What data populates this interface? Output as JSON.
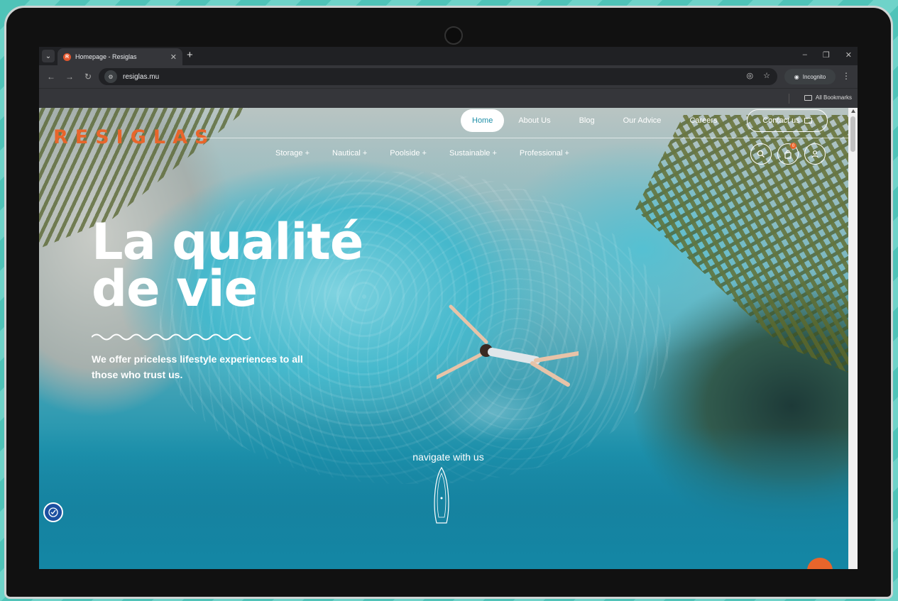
{
  "browser": {
    "tab_title": "Homepage - Resiglas",
    "favicon_letter": "R",
    "url": "resiglas.mu",
    "incognito_label": "Incognito",
    "bookmarks_label": "All Bookmarks"
  },
  "site": {
    "logo": "RESIGLAS",
    "top_nav": [
      "Home",
      "About Us",
      "Blog",
      "Our Advice",
      "Careers"
    ],
    "contact_label": "Contact us",
    "sub_nav": [
      "Storage +",
      "Nautical +",
      "Poolside +",
      "Sustainable +",
      "Professional +"
    ],
    "cart_count": "0"
  },
  "hero": {
    "title_line1": "La qualité",
    "title_line2": "de vie",
    "subtitle": "We offer priceless lifestyle experiences to all those who trust us.",
    "navigate": "navigate with us"
  },
  "colors": {
    "brand_orange": "#e8652b",
    "accent_teal": "#1f8fa8"
  }
}
